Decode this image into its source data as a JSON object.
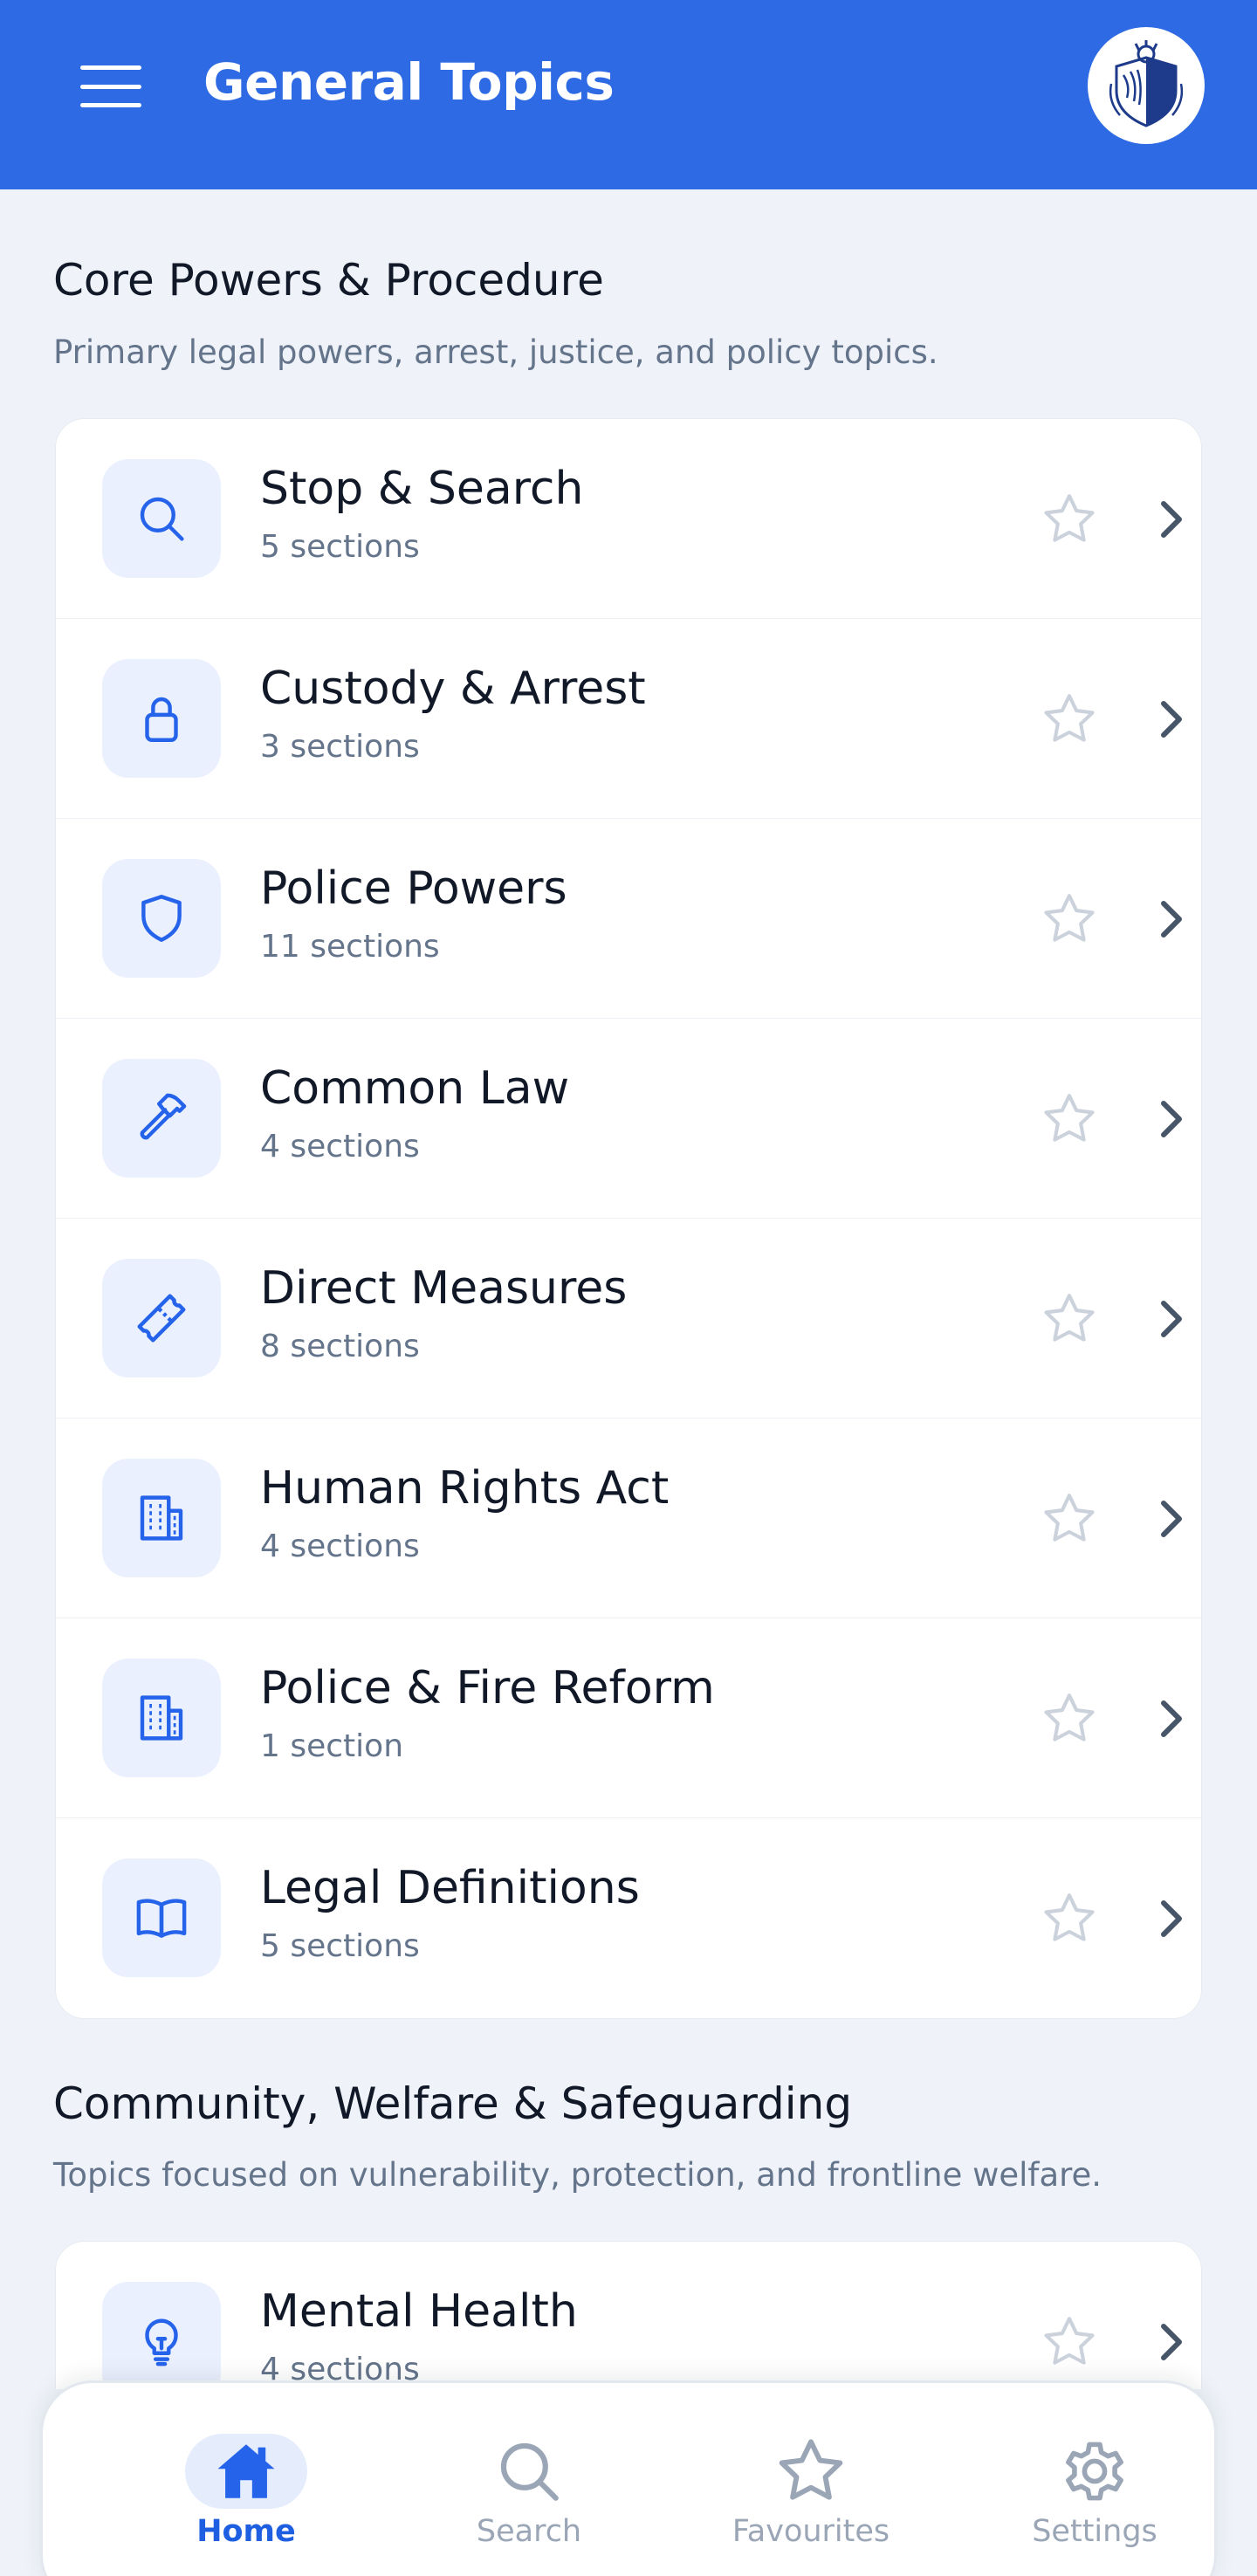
{
  "app_bar": {
    "title": "General Topics",
    "menu_icon": "hamburger-menu-icon",
    "avatar_icon": "crest-logo-icon"
  },
  "sections": [
    {
      "title": "Core Powers & Procedure",
      "subtitle": "Primary legal powers, arrest, justice, and policy topics.",
      "items": [
        {
          "title": "Stop & Search",
          "count": "5 sections",
          "icon": "search-icon"
        },
        {
          "title": "Custody & Arrest",
          "count": "3 sections",
          "icon": "lock-icon"
        },
        {
          "title": "Police Powers",
          "count": "11 sections",
          "icon": "shield-icon"
        },
        {
          "title": "Common Law",
          "count": "4 sections",
          "icon": "hammer-icon"
        },
        {
          "title": "Direct Measures",
          "count": "8 sections",
          "icon": "ticket-icon"
        },
        {
          "title": "Human Rights Act",
          "count": "4 sections",
          "icon": "building-icon"
        },
        {
          "title": "Police & Fire Reform",
          "count": "1 section",
          "icon": "building-icon"
        },
        {
          "title": "Legal Definitions",
          "count": "5 sections",
          "icon": "book-icon"
        }
      ]
    },
    {
      "title": "Community, Welfare & Safeguarding",
      "subtitle": "Topics focused on vulnerability, protection, and frontline welfare.",
      "items": [
        {
          "title": "Mental Health",
          "count": "4 sections",
          "icon": "lightbulb-icon"
        }
      ]
    }
  ],
  "bottom_nav": {
    "items": [
      {
        "label": "Home",
        "icon": "home-icon",
        "active": true
      },
      {
        "label": "Search",
        "icon": "search-icon",
        "active": false
      },
      {
        "label": "Favourites",
        "icon": "star-icon",
        "active": false
      },
      {
        "label": "Settings",
        "icon": "gear-icon",
        "active": false
      }
    ]
  },
  "colors": {
    "primary": "#2d6ae3",
    "background": "#eff3f9",
    "icon_tile": "#eaf0fd",
    "muted_text": "#64748b",
    "star_outline": "#cbd2dc",
    "chevron": "#475569"
  }
}
